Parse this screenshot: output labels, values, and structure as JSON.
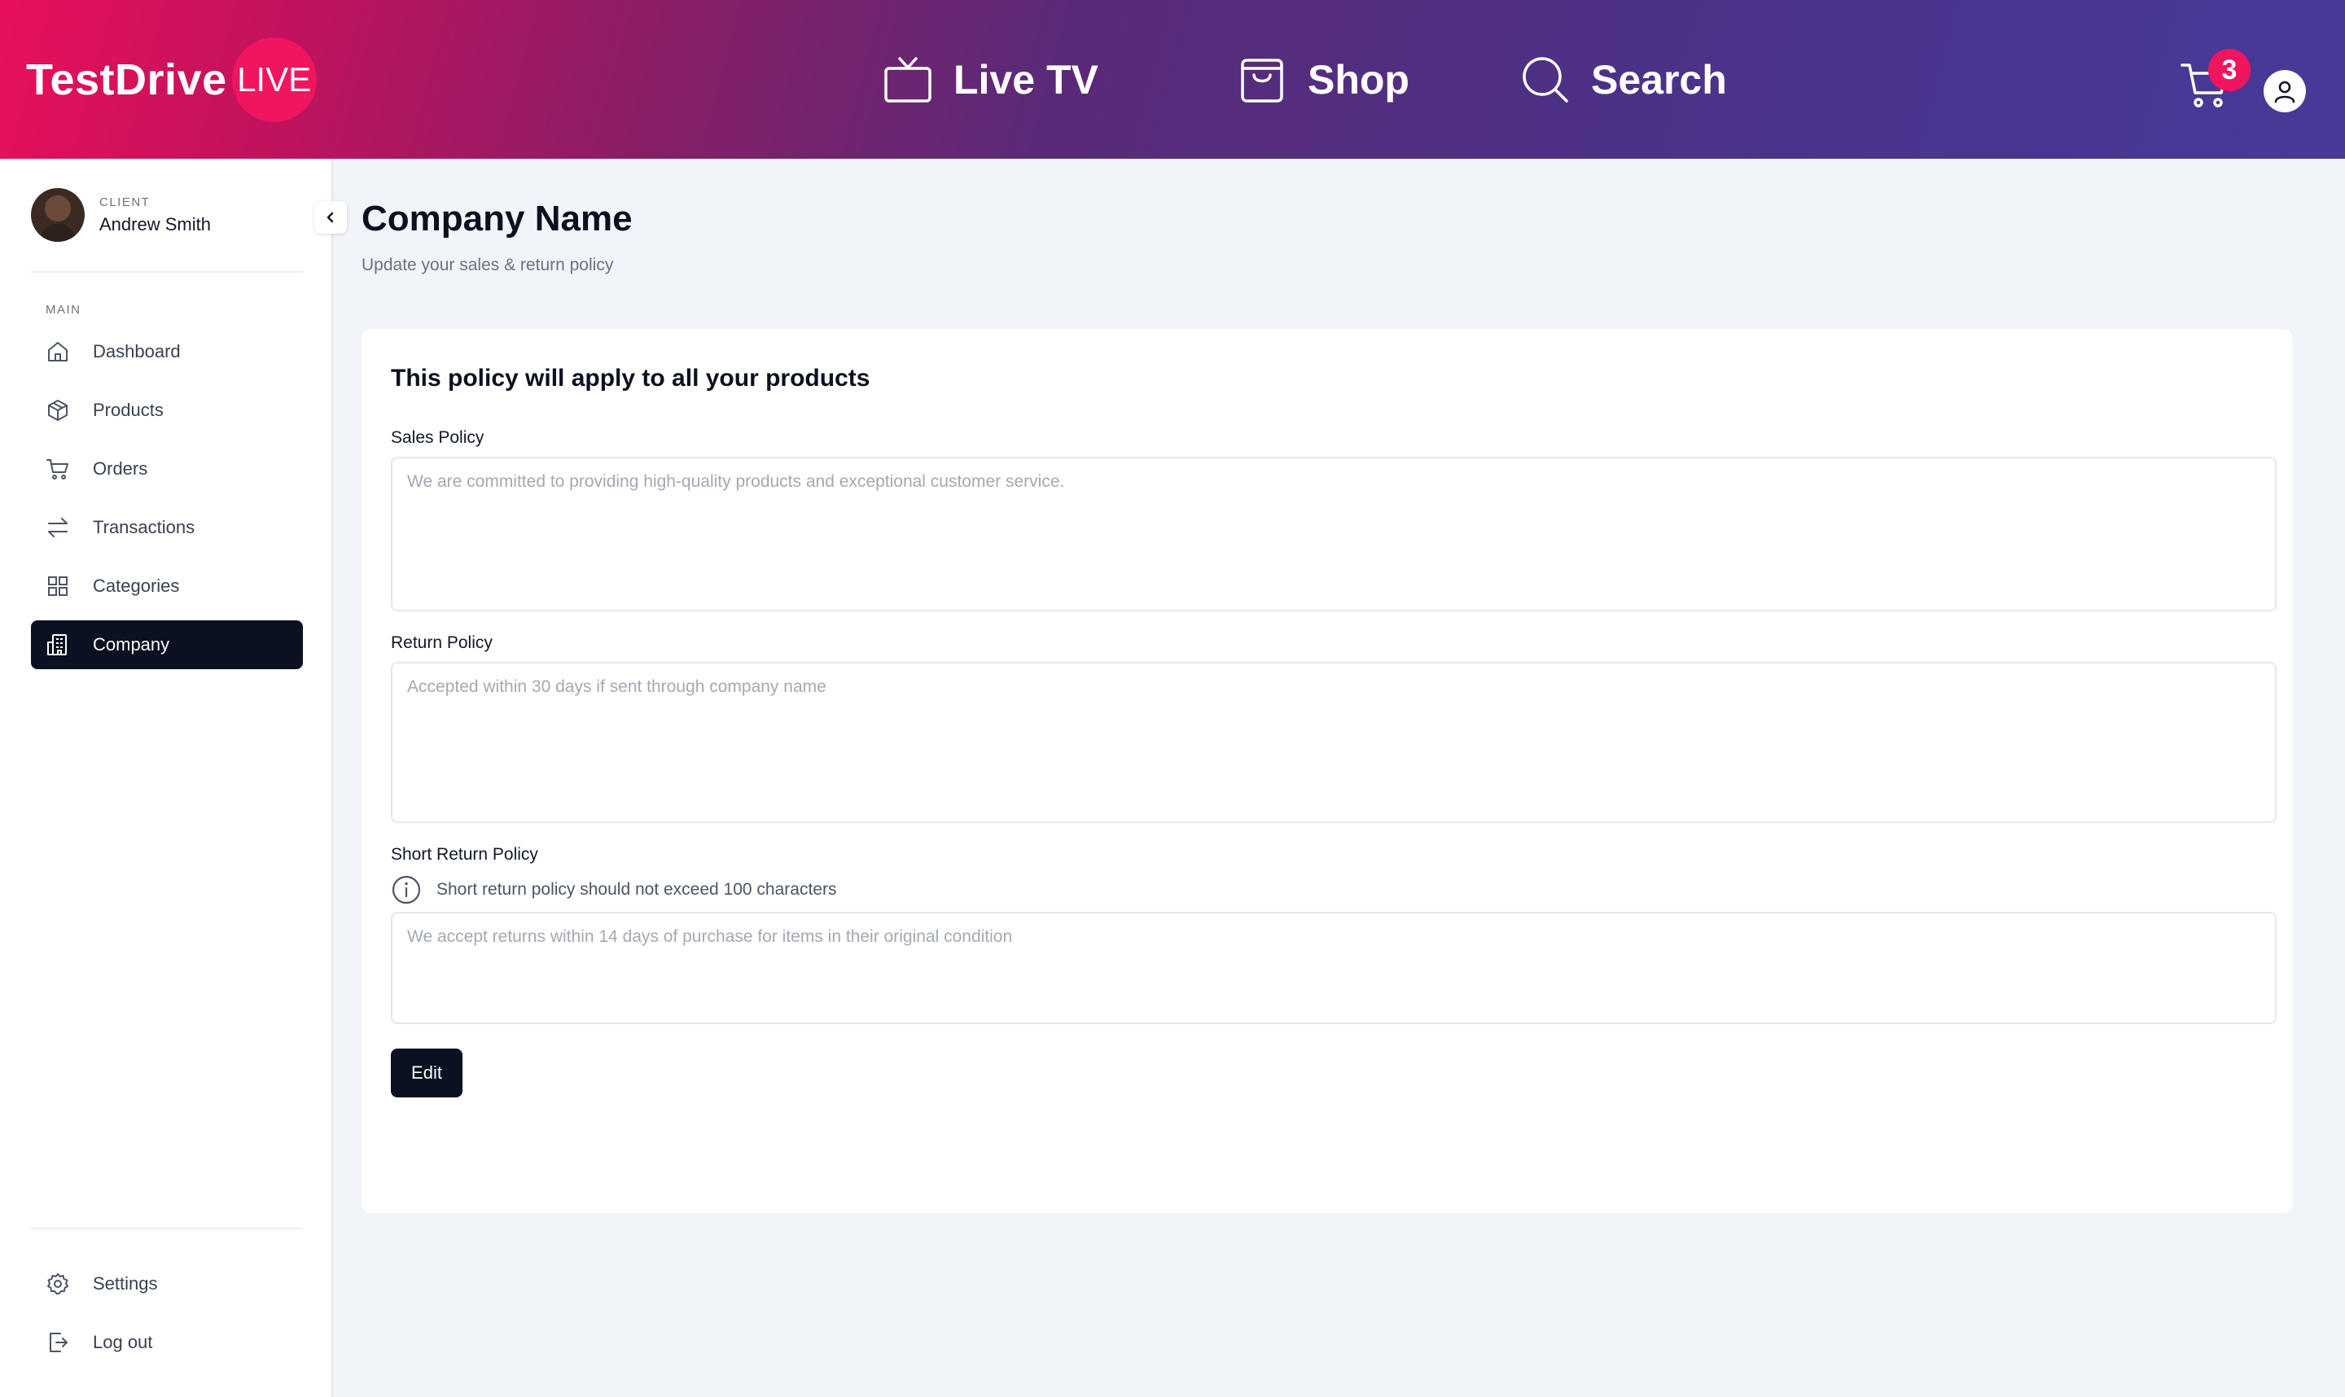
{
  "header": {
    "logo_text": "TestDrive",
    "logo_badge": "LIVE",
    "nav": {
      "live_tv": "Live TV",
      "shop": "Shop",
      "search": "Search"
    },
    "cart_count": "3",
    "colors": {
      "accent": "#f0155f",
      "gradient_start": "#e8105d",
      "gradient_end": "#483a99"
    }
  },
  "sidebar": {
    "user": {
      "role": "CLIENT",
      "name": "Andrew Smith"
    },
    "section_main": "MAIN",
    "items": [
      {
        "label": "Dashboard",
        "icon": "home-icon"
      },
      {
        "label": "Products",
        "icon": "box-icon"
      },
      {
        "label": "Orders",
        "icon": "cart-icon"
      },
      {
        "label": "Transactions",
        "icon": "transfer-icon"
      },
      {
        "label": "Categories",
        "icon": "grid-icon"
      },
      {
        "label": "Company",
        "icon": "building-icon",
        "active": true
      }
    ],
    "footer_items": [
      {
        "label": "Settings",
        "icon": "gear-icon"
      },
      {
        "label": "Log out",
        "icon": "logout-icon"
      }
    ]
  },
  "main": {
    "title": "Company Name",
    "subtitle": "Update your sales & return policy",
    "card": {
      "title": "This policy will apply to all your products",
      "sales_policy": {
        "label": "Sales Policy",
        "placeholder": "We are committed to providing high-quality products and exceptional customer service."
      },
      "return_policy": {
        "label": "Return Policy",
        "placeholder": "Accepted within 30 days if sent through company name"
      },
      "short_return_policy": {
        "label": "Short Return Policy",
        "hint": "Short return policy should not exceed 100 characters",
        "placeholder": "We accept returns within 14 days of purchase for items in their original condition"
      },
      "edit_label": "Edit"
    }
  }
}
